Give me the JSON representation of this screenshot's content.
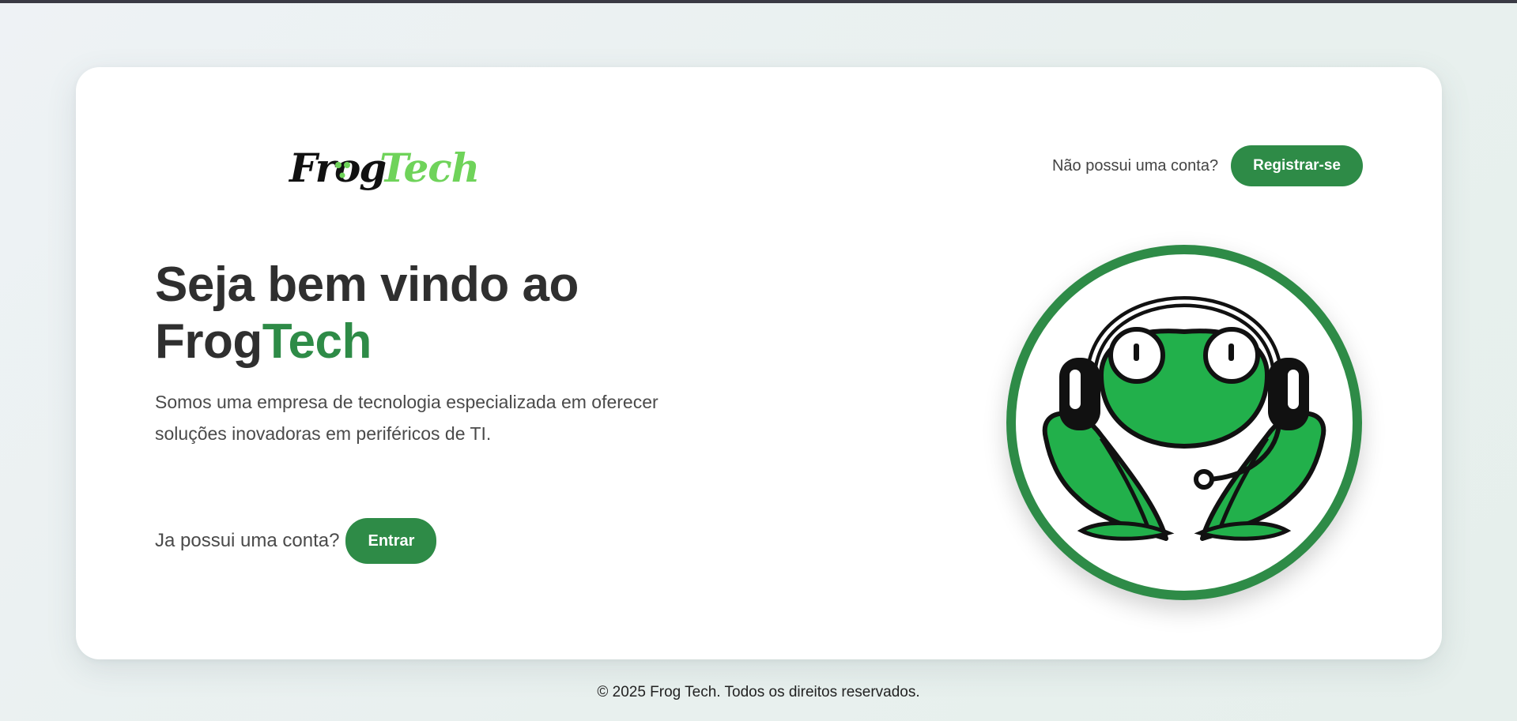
{
  "brand": {
    "logo_text_part1": "Frog",
    "logo_text_part2": "Tech",
    "logo_dark_color": "#111111",
    "logo_green_color": "#6fd35a"
  },
  "header": {
    "register_prompt": "Não possui uma conta?",
    "register_label": "Registrar-se"
  },
  "hero": {
    "title_line1": "Seja bem vindo ao",
    "title_line2_part1": "Frog",
    "title_line2_part2": "Tech",
    "description": "Somos uma empresa de tecnologia especializada em oferecer soluções inovadoras em periféricos de TI."
  },
  "login": {
    "prompt": "Ja possui uma conta?",
    "button_label": "Entrar"
  },
  "illustration": {
    "icon": "frog-headset-icon",
    "ring_color": "#2e8b47",
    "frog_color": "#22b04b"
  },
  "colors": {
    "accent": "#2e8b47",
    "text_dark": "#2f2f2f",
    "text_muted": "#4a4a4a"
  },
  "footer": {
    "copyright": "© 2025 Frog Tech. Todos os direitos reservados."
  }
}
